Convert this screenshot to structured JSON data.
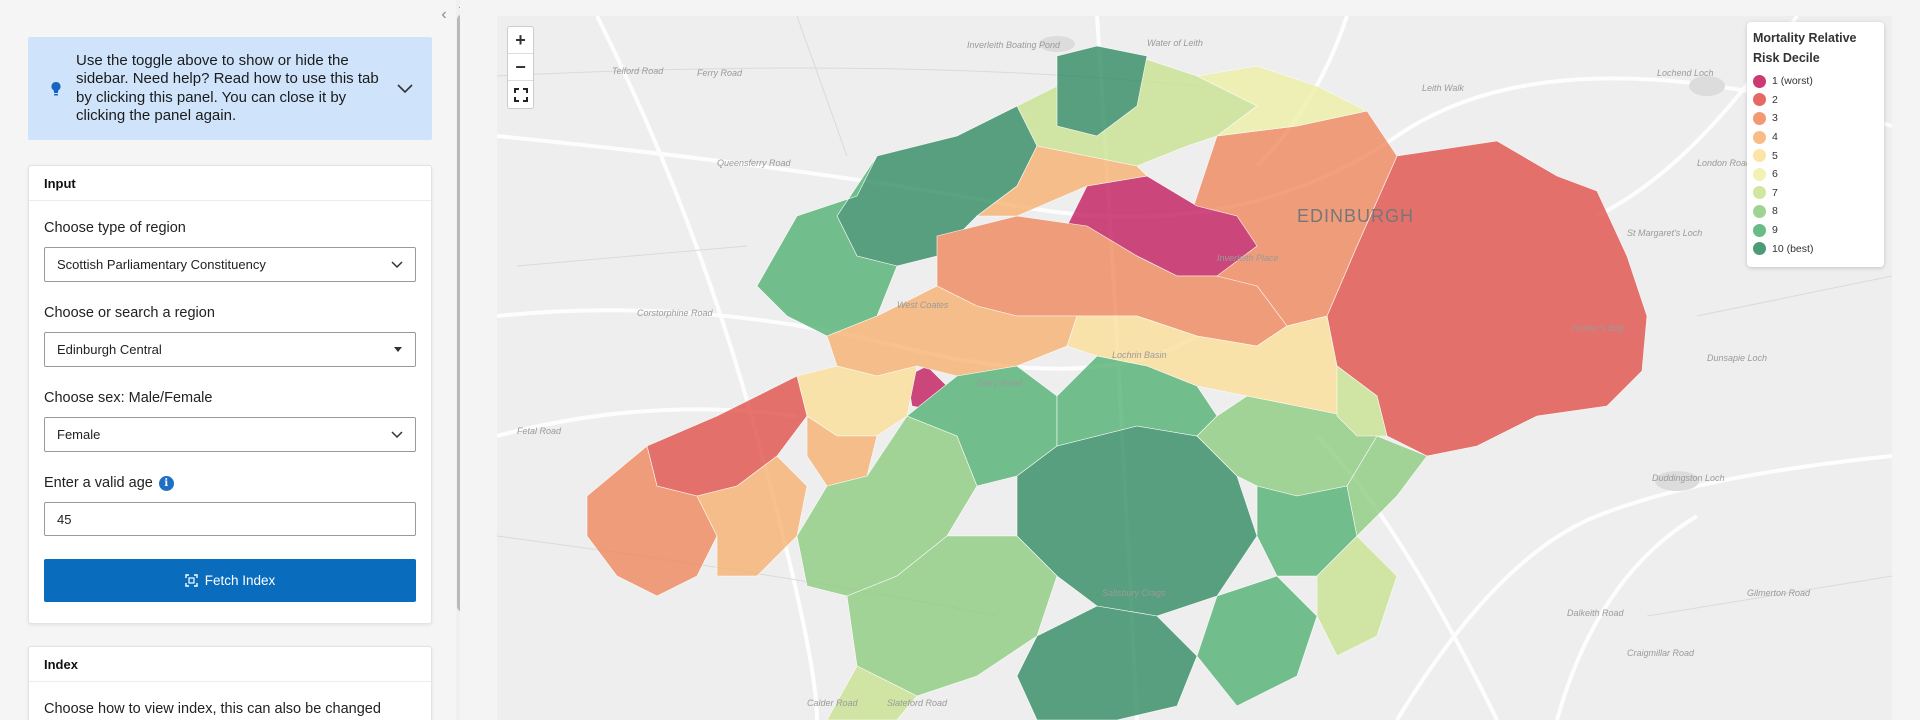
{
  "sidebar": {
    "help_text": "Use the toggle above to show or hide the sidebar. Need help? Read how to use this tab by clicking this panel. You can close it by clicking the panel again.",
    "input_card": {
      "header": "Input",
      "region_type": {
        "label": "Choose type of region",
        "value": "Scottish Parliamentary Constituency"
      },
      "region": {
        "label": "Choose or search a region",
        "value": "Edinburgh Central"
      },
      "sex": {
        "label": "Choose sex: Male/Female",
        "value": "Female"
      },
      "age": {
        "label": "Enter a valid age",
        "value": "45"
      },
      "fetch_label": "Fetch Index"
    },
    "index_card": {
      "header": "Index",
      "description": "Choose how to view index, this can also be changed"
    }
  },
  "map": {
    "city_label": "EDINBURGH",
    "place_labels": [
      "Inverleith Boating Pond",
      "Water of Leith",
      "Telford Road",
      "Ferry Road",
      "Leith Walk",
      "Queensferry Road",
      "Corstorphine Road",
      "West Coates",
      "Lochrin Basin",
      "Dalry Road",
      "St Margaret's Loch",
      "Dunsapie Loch",
      "Hunter's Bog",
      "Duddingston Loch",
      "Calder Road",
      "Slateford Road",
      "Lochend Loch",
      "London Road",
      "Dalkeith Road",
      "Craigmillar Road",
      "Gilmerton Road",
      "Fetal Road",
      "Inverleith Place",
      "Salisbury Crags"
    ],
    "zoom_in": "+",
    "zoom_out": "−"
  },
  "legend": {
    "title": "Mortality Relative Risk Decile",
    "items": [
      {
        "label": "1 (worst)",
        "color": "#c2185b"
      },
      {
        "label": "2",
        "color": "#e24d47"
      },
      {
        "label": "3",
        "color": "#f0865a"
      },
      {
        "label": "4",
        "color": "#f7b06e"
      },
      {
        "label": "5",
        "color": "#fbdf98"
      },
      {
        "label": "6",
        "color": "#eef0a6"
      },
      {
        "label": "7",
        "color": "#c8e390"
      },
      {
        "label": "8",
        "color": "#8dcc7e"
      },
      {
        "label": "9",
        "color": "#4fb070"
      },
      {
        "label": "10 (best)",
        "color": "#2d8a5f"
      }
    ]
  }
}
